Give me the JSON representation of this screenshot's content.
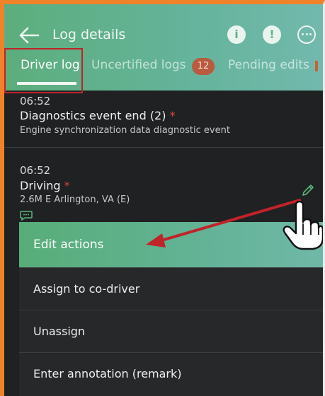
{
  "header": {
    "title": "Log details",
    "icons": [
      "back-arrow-icon",
      "info-icon",
      "alert-icon",
      "more-options-icon"
    ],
    "accent_color": "#5cae7c",
    "info_glyph": "i",
    "alert_glyph": "!"
  },
  "tabs": [
    {
      "label": "Driver log",
      "selected": true
    },
    {
      "label": "Uncertified logs",
      "badge": "12"
    },
    {
      "label": "Pending edits"
    }
  ],
  "events": [
    {
      "time": "06:52",
      "title": "Diagnostics event end (2)",
      "marker": "*",
      "subtitle": "Engine synchronization data diagnostic event"
    },
    {
      "time": "06:52",
      "title": "Driving",
      "marker": "*",
      "subtitle": "2.6M E Arlington, VA (E)"
    }
  ],
  "menu": {
    "header": "Edit actions",
    "items": [
      {
        "label": "Assign to co-driver"
      },
      {
        "label": "Unassign"
      },
      {
        "label": "Enter annotation (remark)"
      }
    ]
  },
  "annotation": {
    "highlight_color": "#c0232a",
    "arrow_color": "#c0232a"
  }
}
